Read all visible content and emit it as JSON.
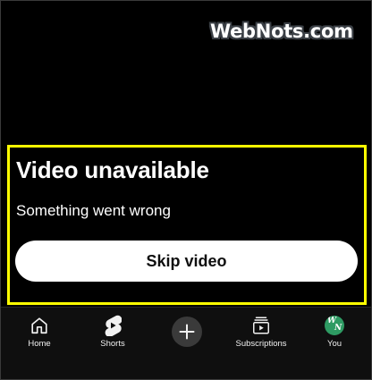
{
  "watermark": {
    "text": "WebNots.com"
  },
  "error": {
    "title": "Video unavailable",
    "subtitle": "Something went wrong",
    "skip_label": "Skip video"
  },
  "nav": {
    "home_label": "Home",
    "shorts_label": "Shorts",
    "subscriptions_label": "Subscriptions",
    "you_label": "You",
    "avatar_initials": [
      "W",
      "N"
    ]
  },
  "colors": {
    "background": "#000000",
    "highlight": "#ffff00",
    "button_bg": "#ffffff",
    "nav_bg": "#0f0f0f",
    "avatar_bg": "#2e9b63"
  }
}
